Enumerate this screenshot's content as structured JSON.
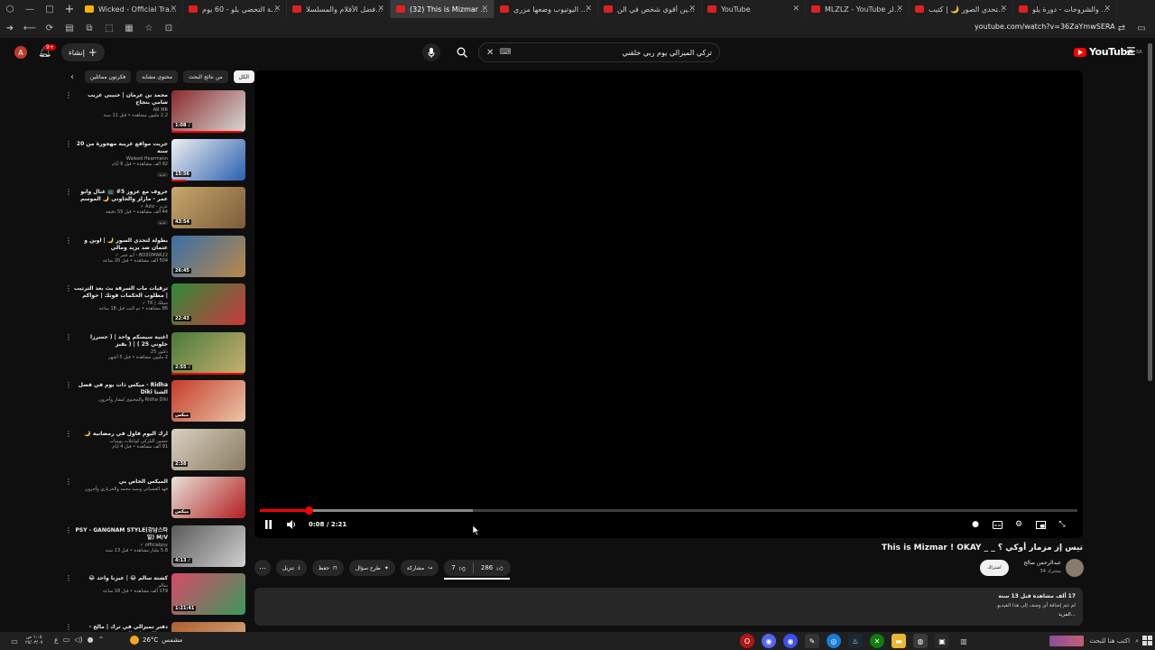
{
  "browser": {
    "tabs": [
      {
        "title": "Wicked - Official Trailer 2 | IM...",
        "fav": "yellow"
      },
      {
        "title": "خطة التحضي يلو - 60 يوم",
        "fav": "red"
      },
      {
        "title": "شاهد أفضل الأفلام والمسلسلا...",
        "fav": "red"
      },
      {
        "title": "(32) This is Mizmar ! OKAY...",
        "fav": "red",
        "active": true
      },
      {
        "title": "بلوك اليوتيوب وضعها مزري...",
        "fav": "red"
      },
      {
        "title": "تحدي مين أقوى شخص في الن...",
        "fav": "red"
      },
      {
        "title": "YouTube",
        "fav": "red"
      },
      {
        "title": "MLZLZ - YouTube مازلز",
        "fav": "red"
      },
      {
        "title": "بطولة لتحدي الصور 🌙 | كتيب...",
        "fav": "red"
      },
      {
        "title": "الدروس والشروحات - دورة يلو...",
        "fav": "red"
      }
    ],
    "url": "youtube.com/watch?v=36ZaYmwSERA"
  },
  "header": {
    "avatar_letter": "A",
    "notif_count": "9+",
    "create_label": "إنشاء",
    "search_value": "تركي الميزالي يوم ربي خلقني",
    "logo_text": "YouTube",
    "logo_region": "SA"
  },
  "chips": {
    "items": [
      "الكل",
      "من نتائج البحث",
      "محتوى مشابه",
      "فكرتون مماثلين"
    ]
  },
  "related": [
    {
      "title": "محمد بن عرمان | حبيبي غريب شامي بنجاح",
      "channel": "AR MR",
      "meta": "2.2 مليون مشاهدة • قبل 11 سنة",
      "badge": "",
      "duration": "1:08 ♪",
      "progress": 0.95,
      "c1": "#8a2a2a",
      "c2": "#d8d8d8"
    },
    {
      "title": "جربت مواقع غريبة مهجورة من 20 سنة",
      "channel": "Waleed Hearmann",
      "meta": "92 ألف مشاهدة • قبل 6 أيام",
      "badge": "جديد",
      "duration": "15:56",
      "progress": 0.2,
      "c1": "#f0f0f0",
      "c2": "#2a5fb0"
    },
    {
      "title": "خروف مع عزوز 5# 📺 غنال وابو عمر - مازلز والحاوني 🌙 الموسم الثالث",
      "channel": "عزيز - Aziz ✓",
      "meta": "44 ألف مشاهدة • قبل 55 دقيقة",
      "badge": "جديد",
      "duration": "43:54",
      "progress": 0.0,
      "c1": "#c9a86b",
      "c2": "#7a5c3a"
    },
    {
      "title": "بطولة لتحدي السور 🌙 | اوبن و عثمان ضد يزيد ومالي",
      "channel": "BO3OMAR22 - أبو عمر ✓",
      "meta": "504 ألف مشاهدة • قبل 20 ساعة",
      "badge": "",
      "duration": "26:45",
      "progress": 0.0,
      "c1": "#3b6ea5",
      "c2": "#b8894a"
    },
    {
      "title": "ترقيات ماب السرقة بث بعد الترتيب | مطلوب الحكمات قوتك | حواكم",
      "channel": "سيلك | TK ✓",
      "meta": "86 مشاهدة • تم البث قبل 18 ساعة",
      "badge": "",
      "duration": "22:43",
      "progress": 0.0,
      "c1": "#2e8b3a",
      "c2": "#c83a3a"
    },
    {
      "title": "اغنية سيسكم واحد | ( حسرزاً خلوني 25 ) | ( بقبز",
      "channel": "دكتور 25",
      "meta": "2 مليون مشاهدة • قبل 5 أشهر",
      "badge": "",
      "duration": "2:55 ♪",
      "progress": 0.98,
      "c1": "#4a7a3a",
      "c2": "#c8b070"
    },
    {
      "title": "Ridha - ميكس ذات يوم في فصل الشتا Diki",
      "channel": "Ridha Diki والمحتوى ليشار وآخرون",
      "meta": "",
      "badge": "",
      "duration": "ميكس",
      "progress": 0.0,
      "c1": "#c83a2a",
      "c2": "#e8c8a8"
    },
    {
      "title": "ارك اليوم فاول في رمضانية 🌙",
      "channel": "حسين البلركي كواعلات يومياب",
      "meta": "91 ألف مشاهدة • قبل 4 أيام",
      "badge": "",
      "duration": "2:38",
      "progress": 0.0,
      "c1": "#d8d0c0",
      "c2": "#8a7a60"
    },
    {
      "title": "الميكس الخاص بي",
      "channel": "فهد العسباني وسيد محمد والحربازي وآخرون",
      "meta": "",
      "badge": "",
      "duration": "ميكس",
      "progress": 0.0,
      "c1": "#e8e0d8",
      "c2": "#b02020"
    },
    {
      "title": "PSY - GANGNAM STYLE(강남스타일) M/V",
      "channel": "officialpsy ✓",
      "meta": "5.8 مليار مشاهدة • قبل 13 سنة",
      "badge": "",
      "duration": "4:13 ♪",
      "progress": 0.0,
      "c1": "#5a5a5a",
      "c2": "#d0d0d0"
    },
    {
      "title": "كشتة سالم 😂 | عيزنا واحد 😂",
      "channel": "سالم",
      "meta": "179 ألف مشاهدة • قبل 18 ساعة",
      "badge": "",
      "duration": "1:21:41",
      "progress": 0.0,
      "c1": "#d84a6a",
      "c2": "#3a9a5a"
    },
    {
      "title": "دفتر تميزالي في ترك | مالج - زرساك هيا و الشرف",
      "channel": "",
      "meta": "",
      "badge": "",
      "duration": "",
      "progress": 0.0,
      "c1": "#b06030",
      "c2": "#d8b080"
    }
  ],
  "player": {
    "time": "0:08 / 2:21",
    "played_fraction": 0.06,
    "buffered_fraction": 0.26
  },
  "video": {
    "title": "تيس إز مزمار أوكي ؟ _ _ This is Mizmar ! OKAY",
    "channel": "عبدالرحمن صالح",
    "subs": "34 مشترك",
    "subscribe_label": "اشتراك",
    "likes": "286",
    "dislikes": "7",
    "share_label": "مشاركة",
    "ask_label": "طرح سؤال",
    "save_label": "حفظ",
    "download_label": "تنزيل",
    "stats": "17 ألف مشاهدة  قبل 13 سنة",
    "description": "لم تتم إضافة أي وصف إلى هذا الفيديو.",
    "more_label": "...المزيد"
  },
  "taskbar": {
    "time": "١:٠٥ ص",
    "date": "٢٥/٠٣/٠٧",
    "weather_temp": "26°C",
    "weather_desc": "مشمس",
    "search_placeholder": "اكتب هنا للبحث"
  }
}
